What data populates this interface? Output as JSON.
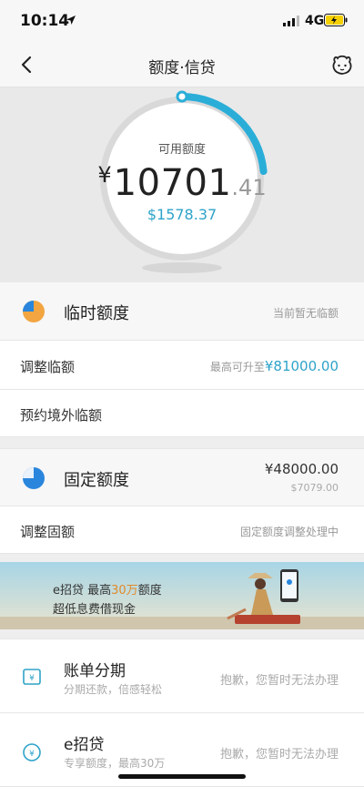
{
  "status_bar": {
    "time": "10:14",
    "network": "4G"
  },
  "nav": {
    "title": "额度·信贷"
  },
  "credit": {
    "available_label": "可用额度",
    "currency_symbol": "¥",
    "amount_integer": "10701",
    "amount_decimal": ".41",
    "usd_amount": "$1578.37"
  },
  "temporary_limit": {
    "title": "临时额度",
    "note": "当前暂无临额",
    "adjust_label": "调整临额",
    "adjust_prefix": "最高可升至",
    "adjust_value": "¥81000.00",
    "overseas_label": "预约境外临额"
  },
  "fixed_limit": {
    "title": "固定额度",
    "value": "¥48000.00",
    "usd_value": "$7079.00",
    "adjust_label": "调整固额",
    "adjust_note": "固定额度调整处理中"
  },
  "banner": {
    "line1_prefix": "e招贷  最高",
    "line1_highlight": "30万",
    "line1_suffix": "额度",
    "line2": "超低息费借现金"
  },
  "services": [
    {
      "title": "账单分期",
      "subtitle": "分期还款，倍感轻松",
      "status": "抱歉，您暂时无法办理"
    },
    {
      "title": "e招贷",
      "subtitle": "专享额度，最高30万",
      "status": "抱歉，您暂时无法办理"
    }
  ],
  "colors": {
    "accent": "#2ea3c9",
    "pie_orange": "#f2a541",
    "pie_blue": "#2a86dd"
  }
}
